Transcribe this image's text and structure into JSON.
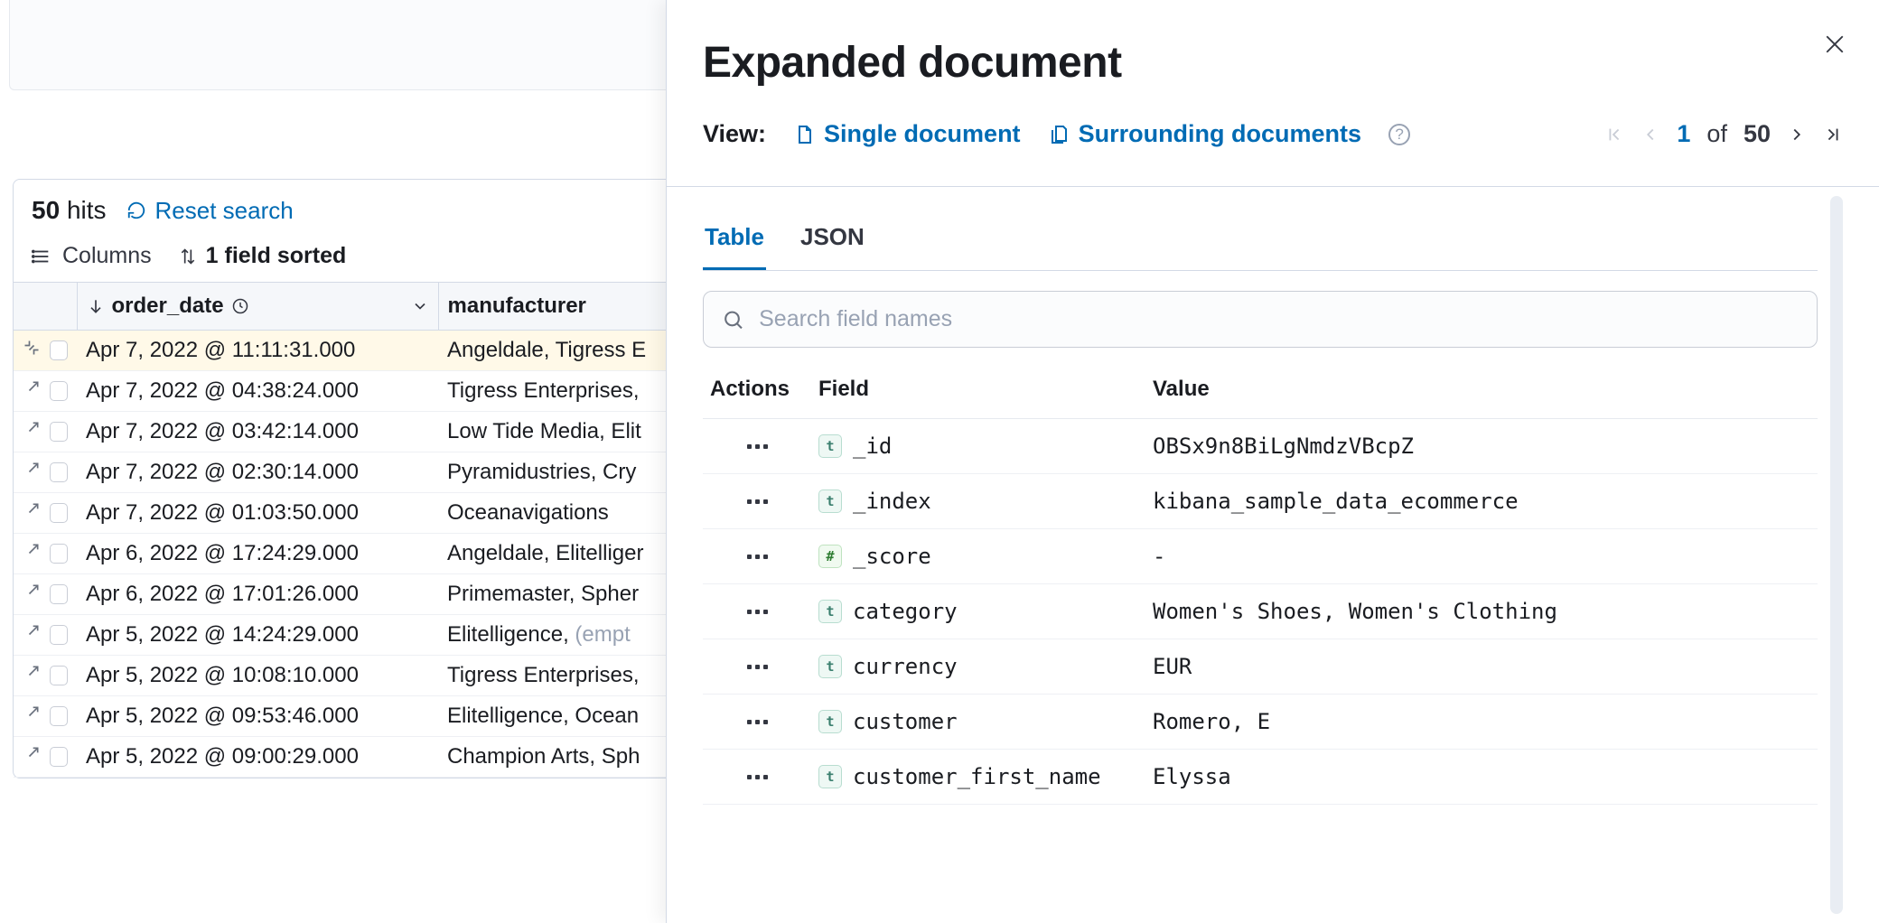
{
  "hits": {
    "count": "50",
    "label": "hits",
    "reset": "Reset search"
  },
  "toolbar": {
    "columns": "Columns",
    "sort_info": "1 field sorted"
  },
  "columns": {
    "order_date": "order_date",
    "manufacturer": "manufacturer"
  },
  "rows": [
    {
      "date": "Apr 7, 2022 @ 11:11:31.000",
      "mfr": "Angeldale, Tigress E",
      "selected": true
    },
    {
      "date": "Apr 7, 2022 @ 04:38:24.000",
      "mfr": "Tigress Enterprises,"
    },
    {
      "date": "Apr 7, 2022 @ 03:42:14.000",
      "mfr": "Low Tide Media, Elit"
    },
    {
      "date": "Apr 7, 2022 @ 02:30:14.000",
      "mfr": "Pyramidustries, Cry"
    },
    {
      "date": "Apr 7, 2022 @ 01:03:50.000",
      "mfr": "Oceanavigations"
    },
    {
      "date": "Apr 6, 2022 @ 17:24:29.000",
      "mfr": "Angeldale, Elitelliger"
    },
    {
      "date": "Apr 6, 2022 @ 17:01:26.000",
      "mfr": "Primemaster, Spher"
    },
    {
      "date": "Apr 5, 2022 @ 14:24:29.000",
      "mfr_pre": "Elitelligence, ",
      "mfr_empty": "(empt"
    },
    {
      "date": "Apr 5, 2022 @ 10:08:10.000",
      "mfr": "Tigress Enterprises,"
    },
    {
      "date": "Apr 5, 2022 @ 09:53:46.000",
      "mfr": "Elitelligence, Ocean"
    },
    {
      "date": "Apr 5, 2022 @ 09:00:29.000",
      "mfr": "Champion Arts, Sph"
    }
  ],
  "flyout": {
    "title": "Expanded document",
    "view_label": "View:",
    "single": "Single document",
    "surrounding": "Surrounding documents",
    "pager": {
      "current": "1",
      "of": "of",
      "total": "50"
    },
    "tabs": {
      "table": "Table",
      "json": "JSON"
    },
    "search_placeholder": "Search field names",
    "headers": {
      "actions": "Actions",
      "field": "Field",
      "value": "Value"
    },
    "fields": [
      {
        "type": "t",
        "name": "_id",
        "value": "OBSx9n8BiLgNmdzVBcpZ"
      },
      {
        "type": "t",
        "name": "_index",
        "value": "kibana_sample_data_ecommerce"
      },
      {
        "type": "n",
        "name": "_score",
        "value": " - "
      },
      {
        "type": "t",
        "name": "category",
        "value": "Women's Shoes, Women's Clothing"
      },
      {
        "type": "t",
        "name": "currency",
        "value": "EUR"
      },
      {
        "type": "t",
        "name": "customer",
        "value": "Romero, E"
      },
      {
        "type": "t",
        "name": "customer_first_name",
        "value": "Elyssa"
      }
    ]
  }
}
